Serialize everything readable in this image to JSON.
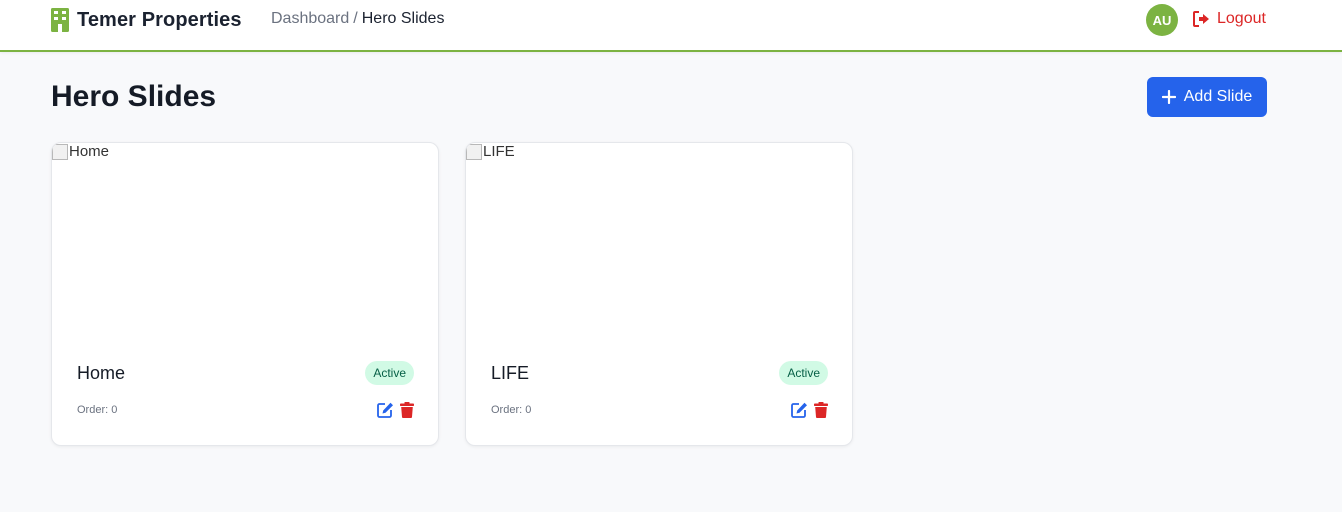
{
  "header": {
    "brand": "Temer Properties",
    "breadcrumb": {
      "parent": "Dashboard",
      "separator": "/",
      "current": "Hero Slides"
    },
    "avatar_initials": "AU",
    "logout_label": "Logout"
  },
  "page": {
    "title": "Hero Slides",
    "add_button_label": "Add Slide"
  },
  "slides": [
    {
      "image_alt": "Home",
      "title": "Home",
      "status": "Active",
      "order": "Order: 0"
    },
    {
      "image_alt": "LIFE",
      "title": "LIFE",
      "status": "Active",
      "order": "Order: 0"
    }
  ],
  "icons": {
    "brand": "building-icon",
    "logout": "sign-out-icon",
    "add": "plus-icon",
    "edit": "edit-icon",
    "delete": "trash-icon"
  },
  "colors": {
    "accent_green": "#7cb342",
    "primary_blue": "#2563eb",
    "danger_red": "#dc2626",
    "badge_bg": "#d1fae5",
    "badge_text": "#065f46"
  }
}
